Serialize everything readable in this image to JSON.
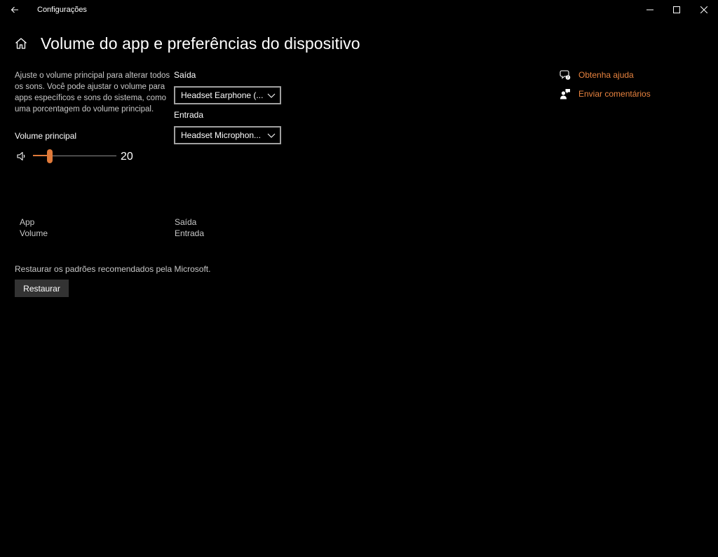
{
  "window": {
    "title": "Configurações"
  },
  "page": {
    "title": "Volume do app e preferências do dispositivo"
  },
  "description": "Ajuste o volume principal para alterar todos os sons. Você pode ajustar o volume para apps específicos e sons do sistema, como uma porcentagem do volume principal.",
  "master_volume": {
    "label": "Volume principal",
    "value": "20",
    "percent": 20
  },
  "output": {
    "label": "Saída",
    "selected": "Headset Earphone (..."
  },
  "input": {
    "label": "Entrada",
    "selected": "Headset Microphon..."
  },
  "columns": {
    "app": "App",
    "volume": "Volume",
    "output": "Saída",
    "input": "Entrada"
  },
  "restore": {
    "text": "Restaurar os padrões recomendados pela Microsoft.",
    "button": "Restaurar"
  },
  "links": {
    "help": "Obtenha ajuda",
    "feedback": "Enviar comentários"
  },
  "colors": {
    "accent": "#e07a3a",
    "link": "#e8833f",
    "background": "#000000",
    "button": "#333333"
  },
  "icons": {
    "back": "back-arrow-icon",
    "minimize": "minimize-icon",
    "maximize": "maximize-icon",
    "close": "close-icon",
    "home": "home-icon",
    "speaker": "speaker-icon",
    "chevron": "chevron-down-icon",
    "help": "help-chat-icon",
    "feedback": "feedback-person-icon"
  }
}
